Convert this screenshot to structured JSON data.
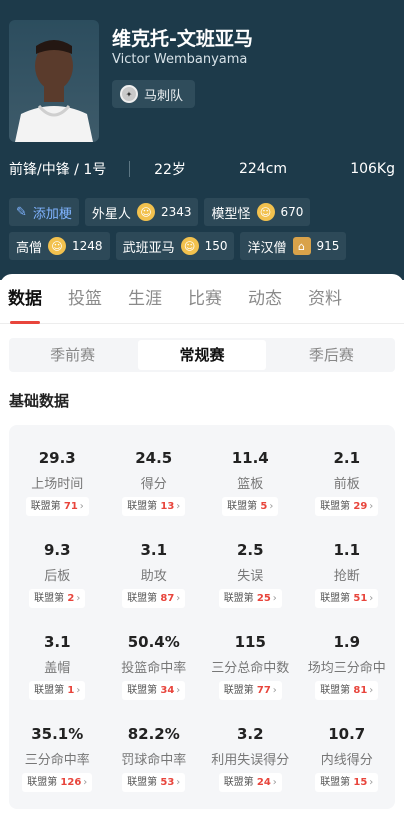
{
  "player": {
    "name_cn": "维克托-文班亚马",
    "name_en": "Victor Wembanyama",
    "team": "马刺队"
  },
  "bio": {
    "position": "前锋/中锋 / 1号",
    "age": "22岁",
    "height": "224cm",
    "weight": "106Kg"
  },
  "tags": {
    "add_label": "添加梗",
    "row1": [
      {
        "label": "外星人",
        "count": "2343",
        "icon": "alien-face-icon"
      },
      {
        "label": "模型怪",
        "count": "670",
        "icon": "dizzy-face-icon"
      }
    ],
    "row2": [
      {
        "label": "高僧",
        "count": "1248",
        "icon": "laugh-face-icon"
      },
      {
        "label": "武班亚马",
        "count": "150",
        "icon": "smirk-face-icon"
      },
      {
        "label": "洋汉僧",
        "count": "915",
        "icon": "temple-icon"
      }
    ]
  },
  "tabs": [
    "数据",
    "投篮",
    "生涯",
    "比赛",
    "动态",
    "资料"
  ],
  "segments": [
    "季前赛",
    "常规赛",
    "季后赛"
  ],
  "section_title": "基础数据",
  "stats": [
    {
      "value": "29.3",
      "label": "上场时间",
      "rank_prefix": "联盟第",
      "rank": "71"
    },
    {
      "value": "24.5",
      "label": "得分",
      "rank_prefix": "联盟第",
      "rank": "13"
    },
    {
      "value": "11.4",
      "label": "篮板",
      "rank_prefix": "联盟第",
      "rank": "5"
    },
    {
      "value": "2.1",
      "label": "前板",
      "rank_prefix": "联盟第",
      "rank": "29"
    },
    {
      "value": "9.3",
      "label": "后板",
      "rank_prefix": "联盟第",
      "rank": "2"
    },
    {
      "value": "3.1",
      "label": "助攻",
      "rank_prefix": "联盟第",
      "rank": "87"
    },
    {
      "value": "2.5",
      "label": "失误",
      "rank_prefix": "联盟第",
      "rank": "25"
    },
    {
      "value": "1.1",
      "label": "抢断",
      "rank_prefix": "联盟第",
      "rank": "51"
    },
    {
      "value": "3.1",
      "label": "盖帽",
      "rank_prefix": "联盟第",
      "rank": "1"
    },
    {
      "value": "50.4%",
      "label": "投篮命中率",
      "rank_prefix": "联盟第",
      "rank": "34"
    },
    {
      "value": "115",
      "label": "三分总命中数",
      "rank_prefix": "联盟第",
      "rank": "77"
    },
    {
      "value": "1.9",
      "label": "场均三分命中",
      "rank_prefix": "联盟第",
      "rank": "81"
    },
    {
      "value": "35.1%",
      "label": "三分命中率",
      "rank_prefix": "联盟第",
      "rank": "126"
    },
    {
      "value": "82.2%",
      "label": "罚球命中率",
      "rank_prefix": "联盟第",
      "rank": "53"
    },
    {
      "value": "3.2",
      "label": "利用失误得分",
      "rank_prefix": "联盟第",
      "rank": "24"
    },
    {
      "value": "10.7",
      "label": "内线得分",
      "rank_prefix": "联盟第",
      "rank": "15"
    }
  ],
  "colors": {
    "header_bg": "#1d3a4a",
    "accent_red": "#e8453c",
    "tag_link_blue": "#7fb3ff"
  }
}
